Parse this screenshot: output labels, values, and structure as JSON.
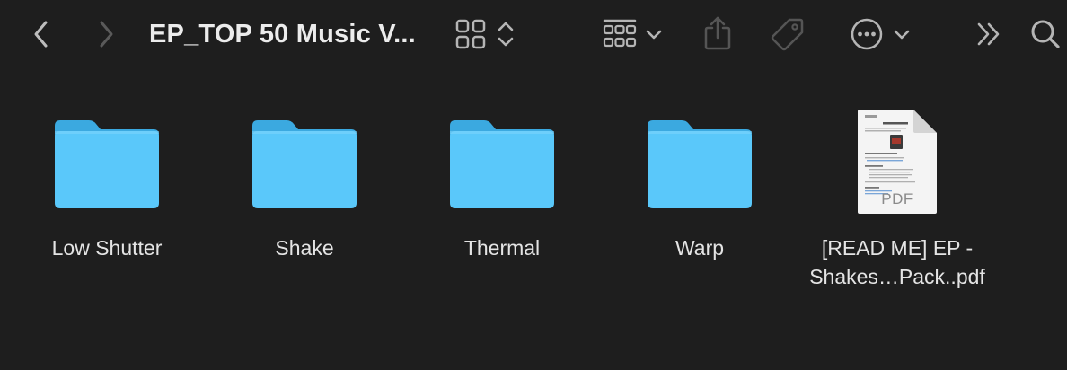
{
  "window": {
    "title": "EP_TOP 50 Music V..."
  },
  "toolbar": {
    "back": "chevron-left-icon",
    "forward": "chevron-right-icon",
    "view_mode": "grid-view-icon",
    "group": "group-by-icon",
    "share": "share-icon",
    "tag": "tag-icon",
    "action": "more-actions-icon",
    "overflow": "double-chevron-right-icon",
    "search": "search-icon"
  },
  "colors": {
    "background": "#1e1e1e",
    "folder_front": "#5ac8fa",
    "folder_back": "#3ba9e0"
  },
  "files": [
    {
      "name": "Low Shutter",
      "kind": "folder"
    },
    {
      "name": "Shake",
      "kind": "folder"
    },
    {
      "name": "Thermal",
      "kind": "folder"
    },
    {
      "name": "Warp",
      "kind": "folder"
    },
    {
      "name_line1": "[READ ME] EP -",
      "name_line2": "Shakes…Pack..pdf",
      "kind": "pdf",
      "badge": "PDF"
    }
  ]
}
